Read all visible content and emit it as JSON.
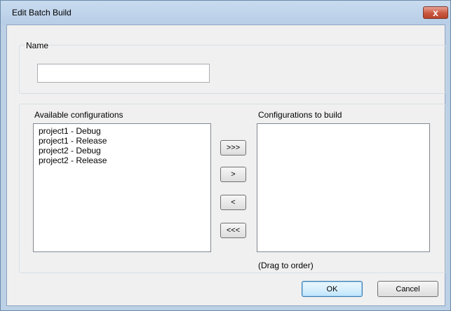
{
  "window": {
    "title": "Edit Batch Build",
    "close_glyph": "x"
  },
  "name_group": {
    "legend": "Name",
    "name_value": ""
  },
  "config_group": {
    "available_label": "Available configurations",
    "available_items": [
      "project1 - Debug",
      "project1 - Release",
      "project2 - Debug",
      "project2 - Release"
    ],
    "build_label": "Configurations to build",
    "build_items": [],
    "drag_hint": "(Drag to order)"
  },
  "move_buttons": {
    "add_all": ">>>",
    "add_one": ">",
    "remove_one": "<",
    "remove_all": "<<<"
  },
  "footer": {
    "ok_label": "OK",
    "cancel_label": "Cancel"
  },
  "colors": {
    "frame": "#bcd0e6",
    "client": "#f0f0f0",
    "close_button": "#c9583f",
    "default_button_border": "#3c7fb1"
  }
}
